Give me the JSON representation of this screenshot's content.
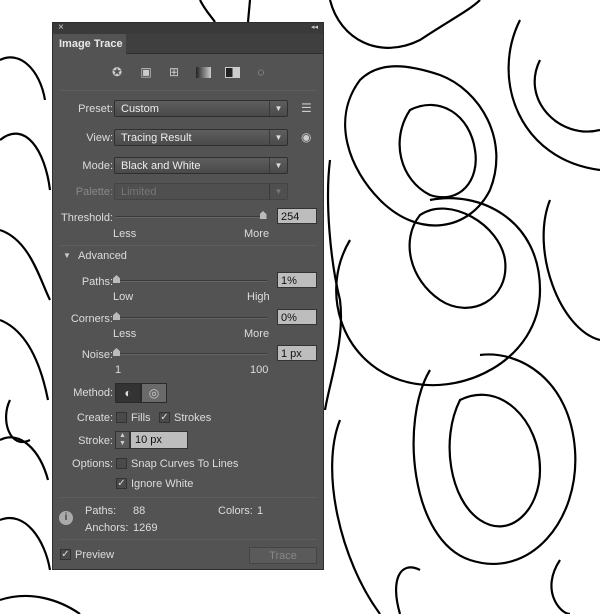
{
  "panel": {
    "title": "Image Trace",
    "close": "×",
    "collapse": "◂◂"
  },
  "presets_icons": [
    "auto-color-icon",
    "high-color-icon",
    "low-color-icon",
    "grayscale-icon",
    "black-white-icon",
    "outline-icon"
  ],
  "preset": {
    "label": "Preset:",
    "value": "Custom"
  },
  "view": {
    "label": "View:",
    "value": "Tracing Result"
  },
  "mode": {
    "label": "Mode:",
    "value": "Black and White"
  },
  "palette": {
    "label": "Palette:",
    "value": "Limited"
  },
  "threshold": {
    "label": "Threshold:",
    "value": "254",
    "min_label": "Less",
    "max_label": "More",
    "fraction": 0.99
  },
  "advanced": {
    "label": "Advanced"
  },
  "paths": {
    "label": "Paths:",
    "value": "1%",
    "min_label": "Low",
    "max_label": "High",
    "fraction": 0.0
  },
  "corners": {
    "label": "Corners:",
    "value": "0%",
    "min_label": "Less",
    "max_label": "More",
    "fraction": 0.0
  },
  "noise": {
    "label": "Noise:",
    "value": "1 px",
    "min_label": "1",
    "max_label": "100",
    "fraction": 0.0
  },
  "method": {
    "label": "Method:"
  },
  "create": {
    "label": "Create:",
    "fills": "Fills",
    "fills_checked": false,
    "strokes": "Strokes",
    "strokes_checked": true
  },
  "stroke": {
    "label": "Stroke:",
    "value": "10 px"
  },
  "options": {
    "label": "Options:",
    "snap": "Snap Curves To Lines",
    "snap_checked": false,
    "ignore_white": "Ignore White",
    "ignore_checked": true
  },
  "stats": {
    "paths_label": "Paths:",
    "paths": "88",
    "colors_label": "Colors:",
    "colors": "1",
    "anchors_label": "Anchors:",
    "anchors": "1269"
  },
  "footer": {
    "preview": "Preview",
    "preview_checked": true,
    "trace": "Trace"
  }
}
